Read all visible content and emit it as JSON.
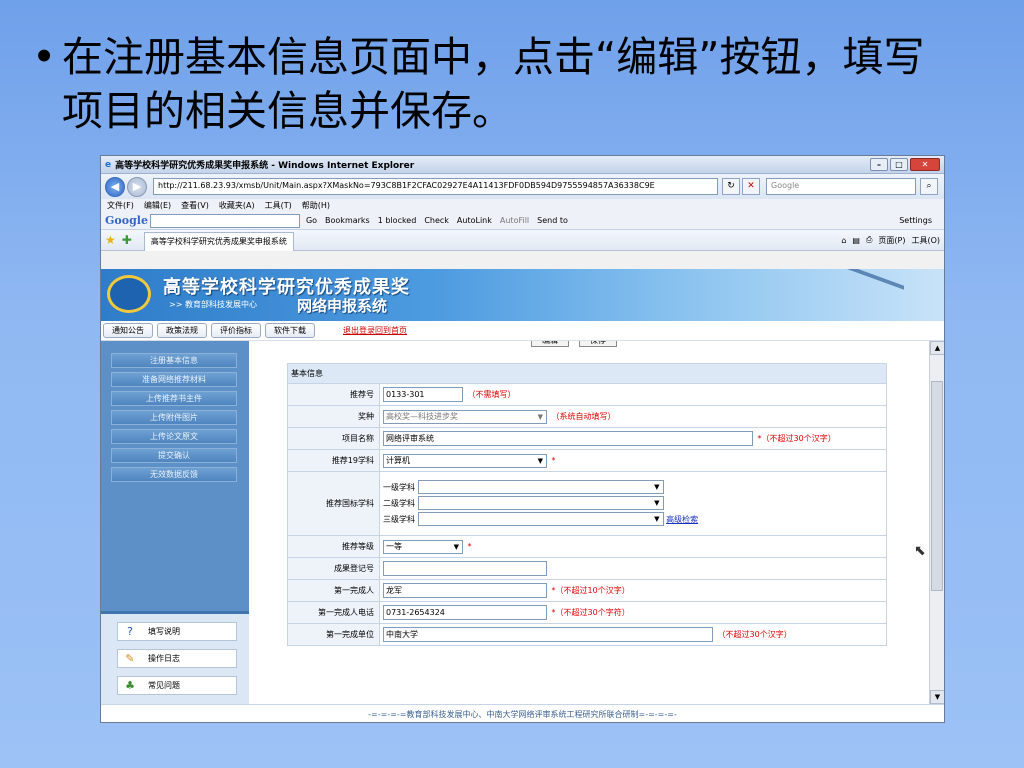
{
  "slide": {
    "bullet": "•",
    "text": "在注册基本信息页面中，点击“编辑”按钮，填写项目的相关信息并保存。"
  },
  "window": {
    "title": "高等学校科学研究优秀成果奖申报系统 - Windows Internet Explorer",
    "url": "http://211.68.23.93/xmsb/Unit/Main.aspx?XMaskNo=793C8B1F2CFAC02927E4A11413FDF0DB594D9755594857A36338C9E",
    "search_placeholder": "Google"
  },
  "menubar": [
    "文件(F)",
    "编辑(E)",
    "查看(V)",
    "收藏夹(A)",
    "工具(T)",
    "帮助(H)"
  ],
  "googlebar": {
    "logo": "Google",
    "go": "Go",
    "items": [
      "Bookmarks",
      "1 blocked",
      "Check",
      "AutoLink",
      "AutoFill",
      "Send to"
    ],
    "settings": "Settings"
  },
  "favbar": {
    "tab_title": "高等学校科学研究优秀成果奖申报系统",
    "tools": [
      "页面(P)",
      "工具(O)"
    ]
  },
  "banner": {
    "title": "高等学校科学研究优秀成果奖",
    "subtitle_left": ">> 教育部科技发展中心",
    "subtitle_right": "网络申报系统"
  },
  "navtabs": [
    "通知公告",
    "政策法规",
    "评价指标",
    "软件下载"
  ],
  "logout": "退出登录回到首页",
  "sidebar": {
    "items": [
      "注册基本信息",
      "准备网络推荐材料",
      "上传推荐书主件",
      "上传附件图片",
      "上传论文原文",
      "提交确认",
      "无效数据反馈"
    ],
    "help": [
      {
        "label": "填写说明",
        "icon": "question-icon"
      },
      {
        "label": "操作日志",
        "icon": "log-icon"
      },
      {
        "label": "常见问题",
        "icon": "faq-icon"
      }
    ]
  },
  "form": {
    "buttons": [
      "编辑",
      "保存"
    ],
    "header": "基本信息",
    "rec_no_label": "推荐号",
    "rec_no_value": "0133-301",
    "rec_no_hint": "（不需填写）",
    "award_label": "奖种",
    "award_value": "高校奖—科技进步奖",
    "award_hint": "（系统自动填写）",
    "project_label": "项目名称",
    "project_value": "网络评审系统",
    "project_hint": "*（不超过30个汉字）",
    "subject19_label": "推荐19学科",
    "subject19_value": "计算机",
    "star": "*",
    "national_label": "推荐国标学科",
    "level1": "一级学科",
    "level2": "二级学科",
    "level3": "三级学科",
    "advanced_search": "高级检索",
    "grade_label": "推荐等级",
    "grade_value": "一等",
    "reg_no_label": "成果登记号",
    "person_label": "第一完成人",
    "person_value": "龙军",
    "person_hint": "*（不超过10个汉字）",
    "phone_label": "第一完成人电话",
    "phone_value": "0731-2654324",
    "phone_hint": "*（不超过30个字符）",
    "unit_label": "第一完成单位",
    "unit_value": "中南大学",
    "unit_hint": "（不超过30个汉字）"
  },
  "footer": "-=-=-=-=教育部科技发展中心、中南大学网络评审系统工程研究所联合研制=-=-=-=-"
}
